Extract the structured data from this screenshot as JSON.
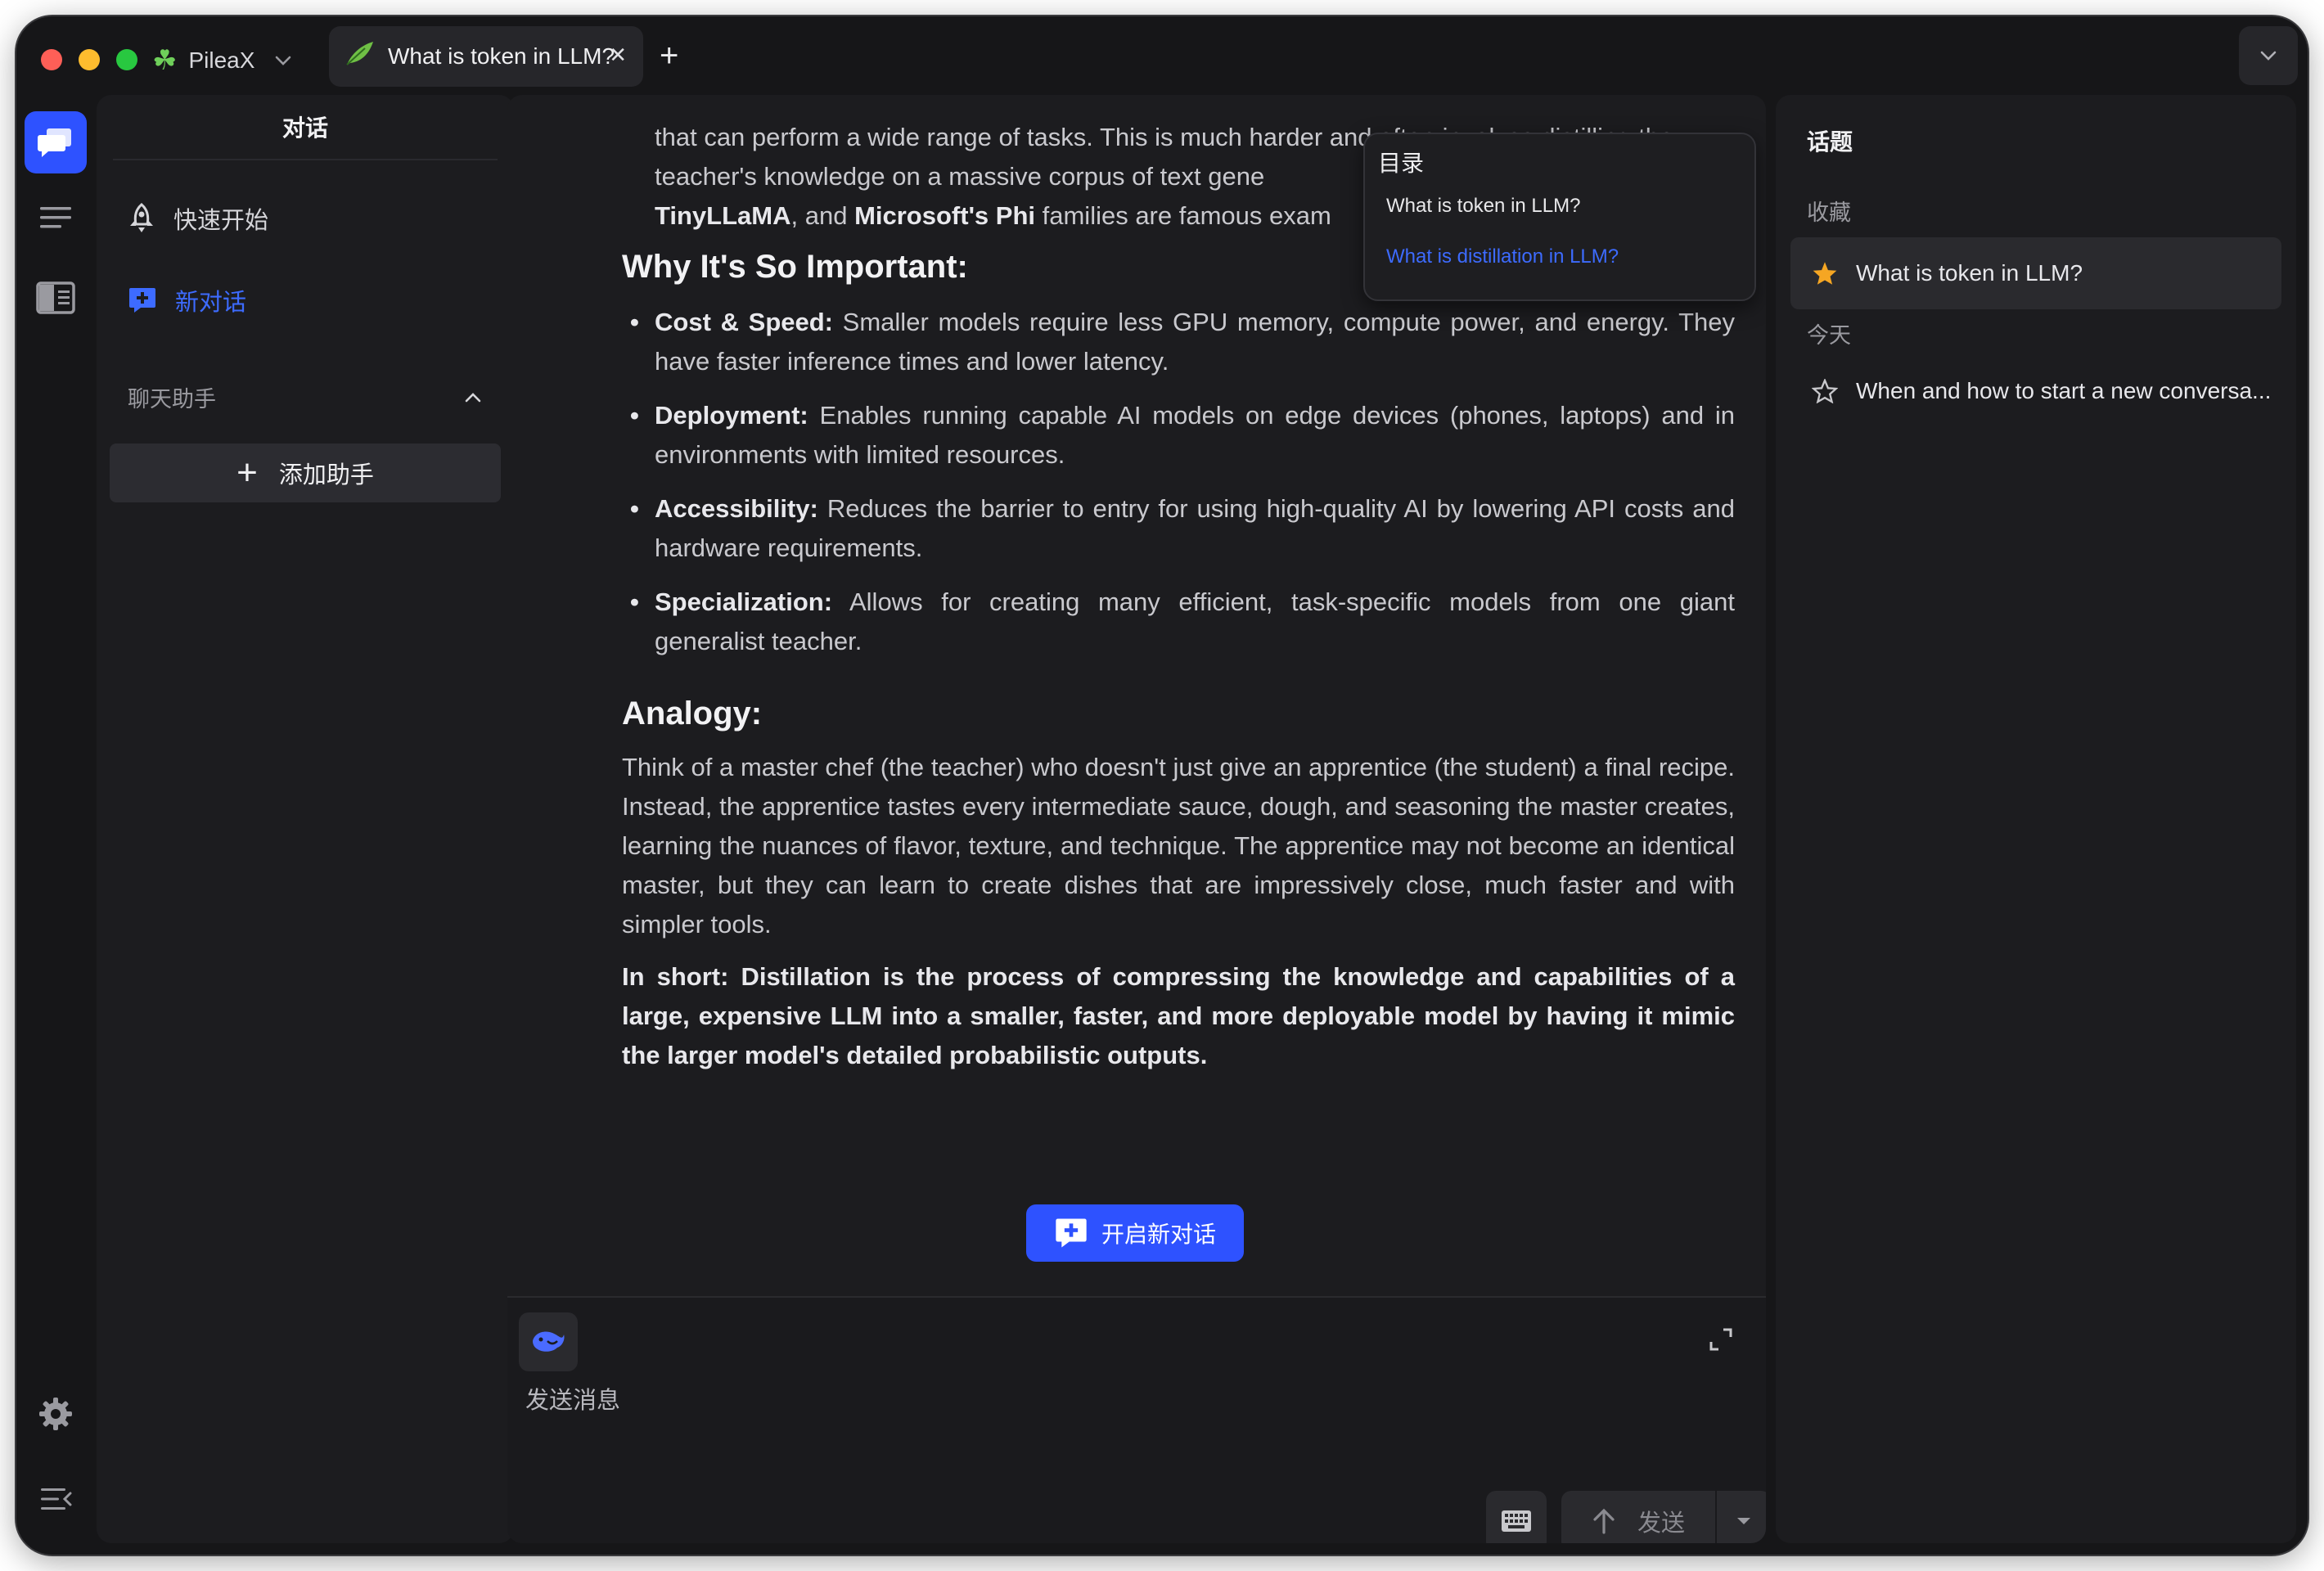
{
  "app": {
    "name": "PileaX"
  },
  "tab": {
    "title": "What is token in LLM?"
  },
  "colors": {
    "accent": "#2e52ff",
    "background": "#161618",
    "star": "#f5a623"
  },
  "sidebar": {
    "title": "对话",
    "quick_start": "快速开始",
    "new_chat": "新对话",
    "section_label": "聊天助手",
    "add_assistant": "添加助手"
  },
  "toc": {
    "title": "目录",
    "items": [
      "What is token in LLM?",
      "What is distillation in LLM?"
    ]
  },
  "content": {
    "top_para_line1": "that can perform a wide range of tasks. This is much harder and often involves distilling the",
    "top_para_line2_a": "teacher's knowledge on a massive corpus of text gene",
    "top_para_line3_b1": "TinyLLaMA",
    "top_para_line3_mid": ", and ",
    "top_para_line3_b2": "Microsoft's Phi",
    "top_para_line3_end": " families are famous exam",
    "why_heading": "Why It's So Important:",
    "bullets": [
      {
        "label": "Cost & Speed:",
        "text": " Smaller models require less GPU memory, compute power, and energy. They have faster inference times and lower latency."
      },
      {
        "label": "Deployment:",
        "text": " Enables running capable AI models on edge devices (phones, laptops) and in environments with limited resources."
      },
      {
        "label": "Accessibility:",
        "text": " Reduces the barrier to entry for using high-quality AI by lowering API costs and hardware requirements."
      },
      {
        "label": "Specialization:",
        "text": " Allows for creating many efficient, task-specific models from one giant generalist teacher."
      }
    ],
    "analogy_heading": "Analogy:",
    "analogy_text": "Think of a master chef (the teacher) who doesn't just give an apprentice (the student) a final recipe. Instead, the apprentice tastes every intermediate sauce, dough, and seasoning the master creates, learning the nuances of flavor, texture, and technique. The apprentice may not become an identical master, but they can learn to create dishes that are impressively close, much faster and with simpler tools.",
    "in_short": "In short: Distillation is the process of compressing the knowledge and capabilities of a large, expensive LLM into a smaller, faster, and more deployable model by having it mimic the larger model's detailed probabilistic outputs."
  },
  "new_conversation_button": "开启新对话",
  "composer": {
    "placeholder": "发送消息",
    "send_label": "发送"
  },
  "topics": {
    "title": "话题",
    "favorites_label": "收藏",
    "today_label": "今天",
    "favorite_items": [
      "What is token in LLM?"
    ],
    "today_items": [
      "When and how to start a new conversa..."
    ]
  }
}
